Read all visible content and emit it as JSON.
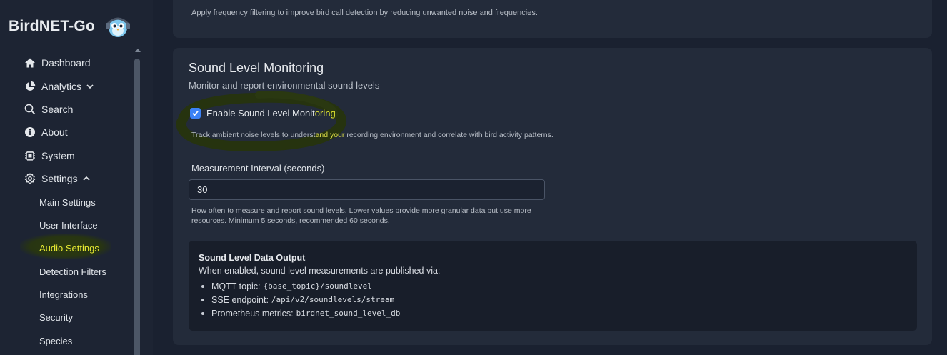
{
  "app": {
    "brand": "BirdNET-Go"
  },
  "sidebar": {
    "items": [
      {
        "label": "Dashboard",
        "icon": "home-icon"
      },
      {
        "label": "Analytics",
        "icon": "pie-chart-icon",
        "chevron": "chevron-down-icon"
      },
      {
        "label": "Search",
        "icon": "search-icon"
      },
      {
        "label": "About",
        "icon": "info-icon"
      },
      {
        "label": "System",
        "icon": "cpu-icon"
      },
      {
        "label": "Settings",
        "icon": "gear-icon",
        "chevron": "chevron-up-icon"
      }
    ],
    "settings_sub": [
      {
        "label": "Main Settings"
      },
      {
        "label": "User Interface"
      },
      {
        "label": "Audio Settings",
        "active": true
      },
      {
        "label": "Detection Filters"
      },
      {
        "label": "Integrations"
      },
      {
        "label": "Security"
      },
      {
        "label": "Species"
      }
    ],
    "active_color": "#e7ea32"
  },
  "top_card": {
    "description": "Apply frequency filtering to improve bird call detection by reducing unwanted noise and frequencies."
  },
  "sound_card": {
    "title": "Sound Level Monitoring",
    "subtitle": "Monitor and report environmental sound levels",
    "checkbox": {
      "label_part1": "Enable Sound Level Monit",
      "label_part2": "oring",
      "checked": true,
      "help_part1": "Track ambient noise levels to underst",
      "help_part2": "and your",
      "help_part3": " recording environment and correlate with bird activity patterns."
    },
    "interval": {
      "label": "Measurement Interval (seconds)",
      "value": "30",
      "help": "How often to measure and report sound levels. Lower values provide more granular data but use more resources. Minimum 5 seconds, recommended 60 seconds."
    },
    "output": {
      "title": "Sound Level Data Output",
      "description": "When enabled, sound level measurements are published via:",
      "items": [
        {
          "label": "MQTT topic:",
          "code": "{base_topic}/soundlevel"
        },
        {
          "label": "SSE endpoint:",
          "code": "/api/v2/soundlevels/stream"
        },
        {
          "label": "Prometheus metrics:",
          "code": "birdnet_sound_level_db"
        }
      ]
    }
  },
  "colors": {
    "background": "#1a2130",
    "card": "#232b3a",
    "accent": "#3b82f6",
    "highlight": "#e7ea32"
  }
}
